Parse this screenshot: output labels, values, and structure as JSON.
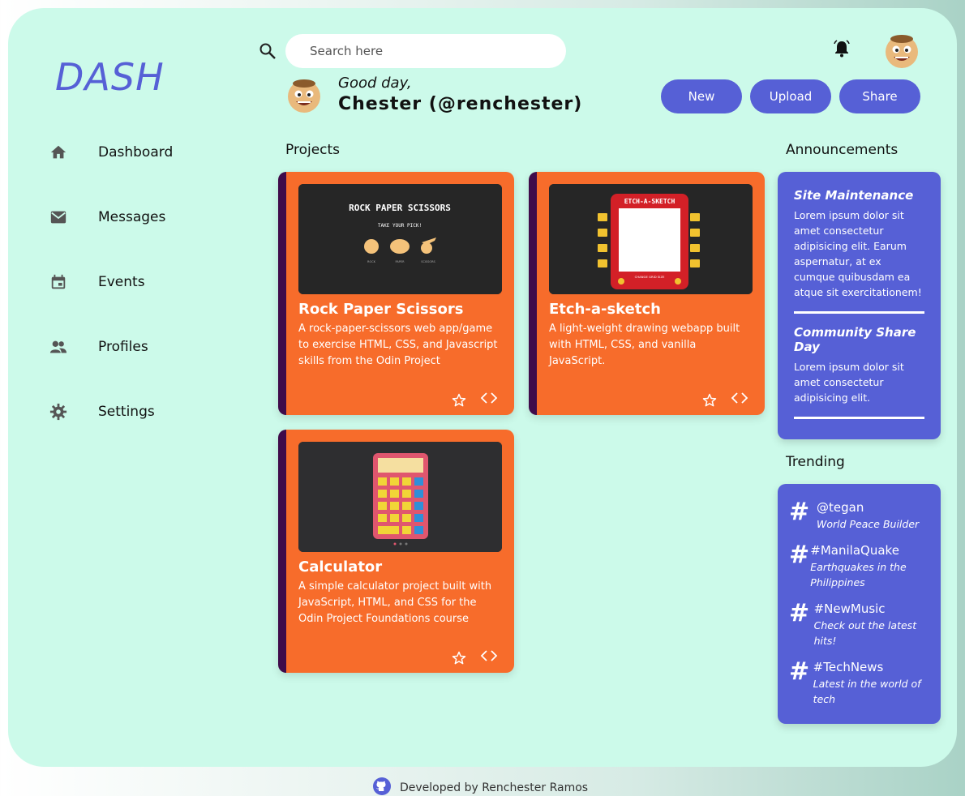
{
  "brand": {
    "logo": "DASH"
  },
  "nav": [
    {
      "label": "Dashboard",
      "icon": "home-icon"
    },
    {
      "label": "Messages",
      "icon": "mail-icon"
    },
    {
      "label": "Events",
      "icon": "calendar-icon"
    },
    {
      "label": "Profiles",
      "icon": "people-icon"
    },
    {
      "label": "Settings",
      "icon": "gear-icon"
    }
  ],
  "header": {
    "search_placeholder": "Search here",
    "greeting": "Good day,",
    "user": "Chester (@renchester)"
  },
  "actions": {
    "new": "New",
    "upload": "Upload",
    "share": "Share"
  },
  "sections": {
    "projects": "Projects",
    "announcements": "Announcements",
    "trending": "Trending"
  },
  "projects": [
    {
      "title": "Rock Paper Scissors",
      "desc": "A rock-paper-scissors web app/game to exercise HTML, CSS, and Javascript skills from the Odin Project",
      "thumb_title": "ROCK PAPER SCISSORS",
      "thumb_sub": "TAKE YOUR PICK!",
      "thumb_opts": [
        "ROCK",
        "PAPER",
        "SCISSORS"
      ]
    },
    {
      "title": "Etch-a-sketch",
      "desc": "A light-weight drawing webapp built with HTML, CSS, and vanilla JavaScript.",
      "thumb_title": "ETCH-A-SKETCH",
      "thumb_sub": "CHANGE GRID SIZE"
    },
    {
      "title": "Calculator",
      "desc": "A simple calculator project built with JavaScript, HTML, and CSS for the Odin Project Foundations course"
    }
  ],
  "announcements": [
    {
      "title": "Site Maintenance",
      "body": "Lorem ipsum dolor sit amet consectetur adipisicing elit. Earum aspernatur, at ex cumque quibusdam ea atque sit exercitationem!"
    },
    {
      "title": "Community Share Day",
      "body": "Lorem ipsum dolor sit amet consectetur adipisicing elit."
    }
  ],
  "trending": [
    {
      "tag": "@tegan",
      "sub": "World Peace Builder"
    },
    {
      "tag": "#ManilaQuake",
      "sub": "Earthquakes in the Philippines"
    },
    {
      "tag": "#NewMusic",
      "sub": "Check out the latest hits!"
    },
    {
      "tag": "#TechNews",
      "sub": "Latest in the world of tech"
    }
  ],
  "footer": {
    "text": "Developed by Renchester Ramos"
  },
  "colors": {
    "accent": "#5660d6",
    "panel": "#ccfaea",
    "card": "#f76c2b",
    "card_border": "#3f0b4a"
  }
}
